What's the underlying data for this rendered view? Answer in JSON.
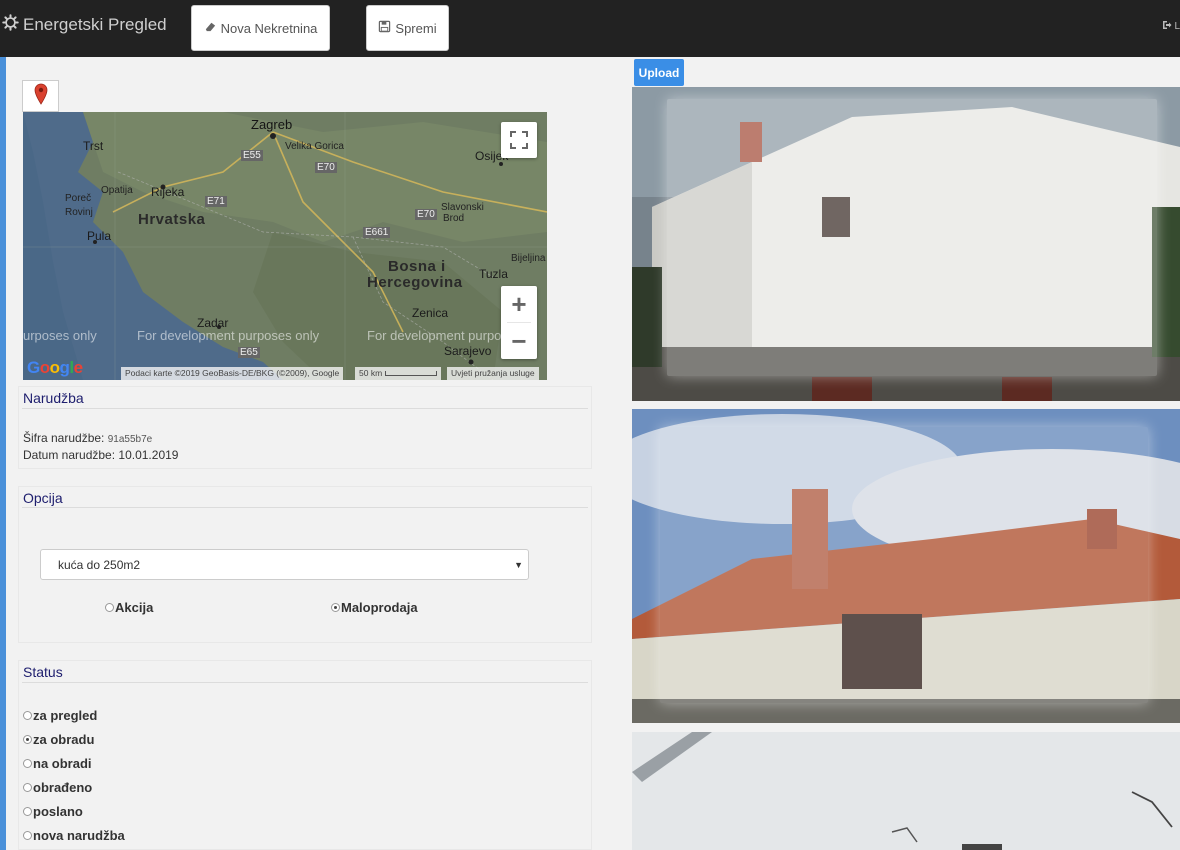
{
  "app": {
    "brand": "Energetski Pregled",
    "brand_icon": "gear-icon",
    "new_property_label": "Nova Nekretnina",
    "save_label": "Spremi",
    "logout_label": "L"
  },
  "map": {
    "marker_icon": "map-marker-icon",
    "labels": {
      "zagreb": "Zagreb",
      "velika_gorica": "Velika Gorica",
      "trst": "Trst",
      "rijeka": "Rijeka",
      "porec": "Poreč",
      "opatija": "Opatija",
      "rovinj": "Rovinj",
      "pula": "Pula",
      "hrvatska": "Hrvatska",
      "osijek": "Osijek",
      "slavonski_brod": "Slavonski Brod",
      "bijeljina": "Bijeljina",
      "tuzla": "Tuzla",
      "bosna": "Bosna i",
      "hercegovina": "Hercegovina",
      "zadar": "Zadar",
      "zenica": "Zenica",
      "sarajevo": "Sarajevo",
      "e55": "E55",
      "e70": "E70",
      "e71": "E71",
      "e661": "E661",
      "e65": "E65"
    },
    "dev_notice": "For development purposes only",
    "dev_notice_partial_left": "urposes only",
    "dev_notice_partial_right": "For development purpo",
    "google_logo": "Google",
    "attribution": "Podaci karte ©2019 GeoBasis-DE/BKG (©2009), Google",
    "scale": "50 km",
    "terms": "Uvjeti pružanja usluge",
    "zoom_in": "+",
    "zoom_out": "−"
  },
  "order": {
    "title": "Narudžba",
    "code_label": "Šifra narudžbe:",
    "code_value": "91a55b7e",
    "date_label": "Datum narudžbe:",
    "date_value": "10.01.2019"
  },
  "option": {
    "title": "Opcija",
    "selected": "kuća do 250m2",
    "radios": [
      {
        "label": "Akcija",
        "checked": false
      },
      {
        "label": "Maloprodaja",
        "checked": true
      }
    ]
  },
  "status": {
    "title": "Status",
    "items": [
      {
        "label": "za pregled",
        "checked": false
      },
      {
        "label": "za obradu",
        "checked": true
      },
      {
        "label": "na obradi",
        "checked": false
      },
      {
        "label": "obrađeno",
        "checked": false
      },
      {
        "label": "poslano",
        "checked": false
      },
      {
        "label": "nova narudžba",
        "checked": false
      }
    ]
  },
  "photos": {
    "upload_label": "Upload"
  }
}
